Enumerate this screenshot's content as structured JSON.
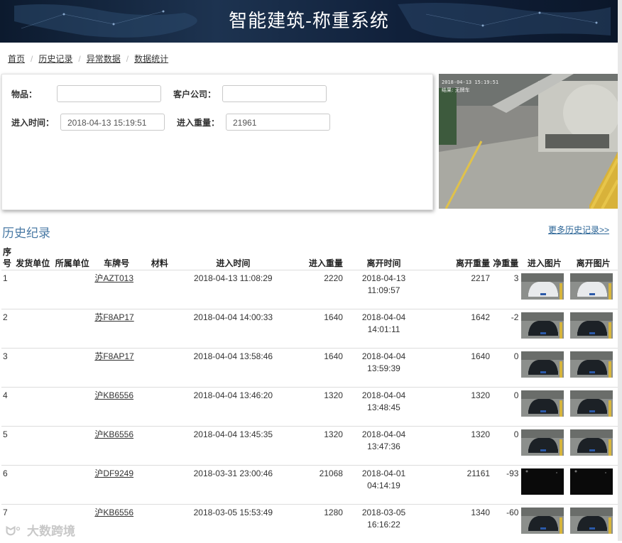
{
  "header": {
    "title": "智能建筑-称重系统"
  },
  "breadcrumb": [
    "首页",
    "历史记录",
    "异常数据",
    "数据统计"
  ],
  "form": {
    "goods_label": "物品：",
    "goods_value": "",
    "customer_label": "客户公司：",
    "customer_value": "",
    "entry_time_label": "进入时间：",
    "entry_time_value": "2018-04-13 15:19:51",
    "entry_weight_label": "进入重量：",
    "entry_weight_value": "21961"
  },
  "camera": {
    "overlay_text": "2018-04-13 15:19:51",
    "overlay_sub": "结果: 无牌车"
  },
  "history": {
    "title": "历史纪录",
    "more_link": "更多历史记录>>",
    "columns": {
      "seq": "序号",
      "consignor": "发货单位",
      "owner": "所属单位",
      "plate": "车牌号",
      "material": "材料",
      "entry_time": "进入时间",
      "entry_weight": "进入重量",
      "exit_time": "离开时间",
      "exit_weight": "离开重量",
      "net_weight": "净重量",
      "entry_image": "进入图片",
      "exit_image": "离开图片"
    },
    "rows": [
      {
        "seq": "1",
        "plate": "沪AZT013",
        "entry_time": "2018-04-13 11:08:29",
        "entry_weight": "2220",
        "exit_date": "2018-04-13",
        "exit_clock": "11:09:57",
        "exit_weight": "2217",
        "net": "3",
        "img": "white-car"
      },
      {
        "seq": "2",
        "plate": "苏F8AP17",
        "entry_time": "2018-04-04 14:00:33",
        "entry_weight": "1640",
        "exit_date": "2018-04-04",
        "exit_clock": "14:01:11",
        "exit_weight": "1642",
        "net": "-2",
        "img": "dark-car"
      },
      {
        "seq": "3",
        "plate": "苏F8AP17",
        "entry_time": "2018-04-04 13:58:46",
        "entry_weight": "1640",
        "exit_date": "2018-04-04",
        "exit_clock": "13:59:39",
        "exit_weight": "1640",
        "net": "0",
        "img": "dark-car"
      },
      {
        "seq": "4",
        "plate": "沪KB6556",
        "entry_time": "2018-04-04 13:46:20",
        "entry_weight": "1320",
        "exit_date": "2018-04-04",
        "exit_clock": "13:48:45",
        "exit_weight": "1320",
        "net": "0",
        "img": "dark-car"
      },
      {
        "seq": "5",
        "plate": "沪KB6556",
        "entry_time": "2018-04-04 13:45:35",
        "entry_weight": "1320",
        "exit_date": "2018-04-04",
        "exit_clock": "13:47:36",
        "exit_weight": "1320",
        "net": "0",
        "img": "dark-car"
      },
      {
        "seq": "6",
        "plate": "沪DF9249",
        "entry_time": "2018-03-31 23:00:46",
        "entry_weight": "21068",
        "exit_date": "2018-04-01",
        "exit_clock": "04:14:19",
        "exit_weight": "21161",
        "net": "-93",
        "img": "night"
      },
      {
        "seq": "7",
        "plate": "沪KB6556",
        "entry_time": "2018-03-05 15:53:49",
        "entry_weight": "1280",
        "exit_date": "2018-03-05",
        "exit_clock": "16:16:22",
        "exit_weight": "1340",
        "net": "-60",
        "img": "dark-car"
      }
    ]
  },
  "watermark": "大数跨境",
  "colors": {
    "header_bg": "#10203a",
    "section_title": "#4a7aa5",
    "link": "#2a6496"
  }
}
